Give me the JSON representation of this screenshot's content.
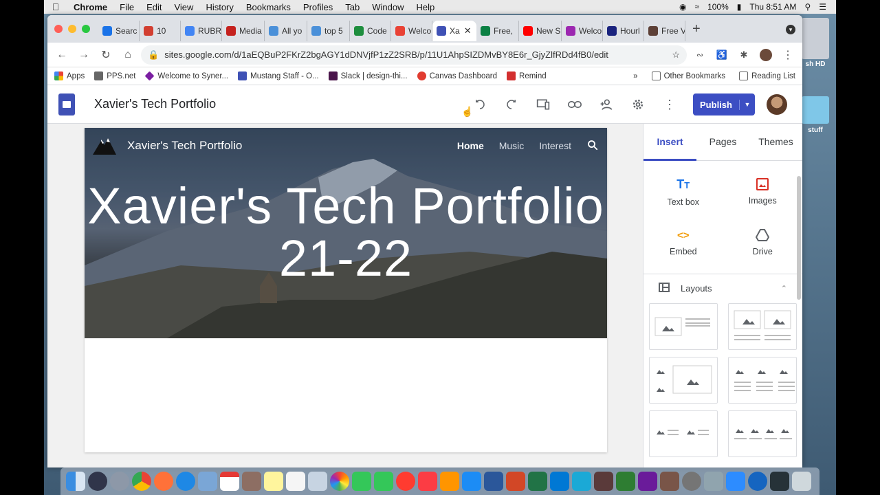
{
  "menubar": {
    "app": "Chrome",
    "items": [
      "File",
      "Edit",
      "View",
      "History",
      "Bookmarks",
      "Profiles",
      "Tab",
      "Window",
      "Help"
    ],
    "battery": "100%",
    "clock": "Thu 8:51 AM"
  },
  "desktop": {
    "drive_label": "sh HD",
    "folder_label": "stuff"
  },
  "tabs": [
    {
      "label": "Searc",
      "color": "#1a73e8"
    },
    {
      "label": "10",
      "color": "#d23f31"
    },
    {
      "label": "RUBR",
      "color": "#4285f4"
    },
    {
      "label": "Media",
      "color": "#c5221f"
    },
    {
      "label": "All yo",
      "color": "#4a90d9"
    },
    {
      "label": "top 5",
      "color": "#4a90d9"
    },
    {
      "label": "Code",
      "color": "#1e8e3e"
    },
    {
      "label": "Welco",
      "color": "#e94235"
    },
    {
      "label": "Xa",
      "color": "#3f51b5"
    },
    {
      "label": "Free,",
      "color": "#0b8043"
    },
    {
      "label": "New S",
      "color": "#ff0000"
    },
    {
      "label": "Welco",
      "color": "#9c27b0"
    },
    {
      "label": "Hourl",
      "color": "#1a237e"
    },
    {
      "label": "Free V",
      "color": "#5d4037"
    }
  ],
  "omnibox": {
    "url": "sites.google.com/d/1aEQBuP2FKrZ2bgAGY1dDNVjfP1zZ2SRB/p/11U1AhpSIZDMvBY8E6r_GjyZlfRDd4fB0/edit"
  },
  "bookmarks": {
    "items": [
      {
        "label": "Apps",
        "color": "#ea4335"
      },
      {
        "label": "PPS.net",
        "color": "#555"
      },
      {
        "label": "Welcome to Syner...",
        "color": "#7b1fa2"
      },
      {
        "label": "Mustang Staff - O...",
        "color": "#3f51b5"
      },
      {
        "label": "Slack | design-thi...",
        "color": "#4a154b"
      },
      {
        "label": "Canvas Dashboard",
        "color": "#e13c30"
      },
      {
        "label": "Remind",
        "color": "#d32f2f"
      }
    ],
    "more": "»",
    "other": "Other Bookmarks",
    "reading": "Reading List"
  },
  "sites": {
    "doc_title": "Xavier's Tech Portfolio",
    "publish_label": "Publish"
  },
  "hero": {
    "site_name": "Xavier's Tech Portfolio",
    "nav": [
      "Home",
      "Music",
      "Interest"
    ],
    "title": "Xavier's Tech Portfolio 21-22"
  },
  "panel": {
    "tabs": [
      "Insert",
      "Pages",
      "Themes"
    ],
    "items": [
      {
        "label": "Text box",
        "icon": "text-box-icon"
      },
      {
        "label": "Images",
        "icon": "image-icon"
      },
      {
        "label": "Embed",
        "icon": "embed-icon"
      },
      {
        "label": "Drive",
        "icon": "drive-icon"
      }
    ],
    "layouts_label": "Layouts"
  }
}
